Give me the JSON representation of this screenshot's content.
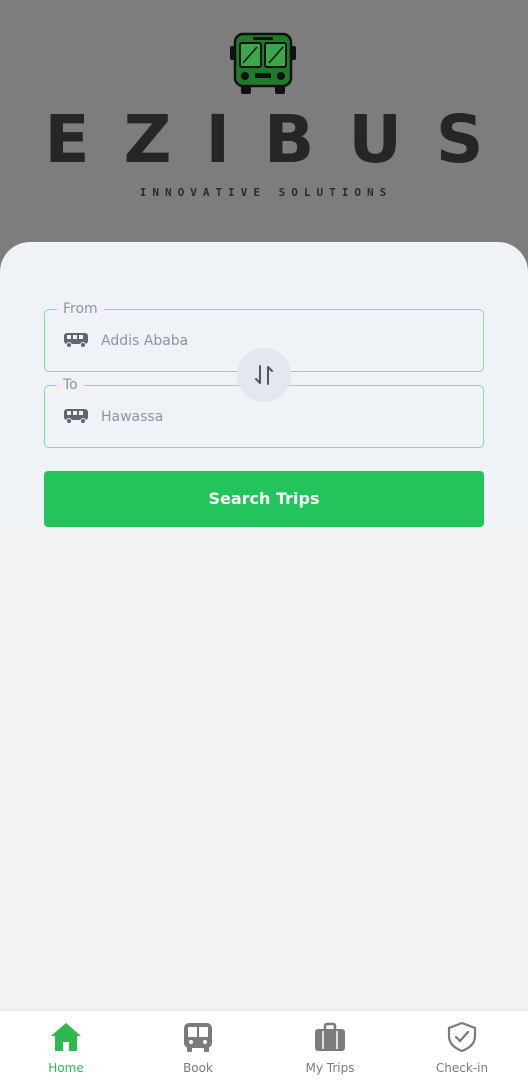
{
  "header": {
    "brand": "EZIBUS",
    "tagline": "INNOVATIVE SOLUTIONS",
    "logo_icon": "bus-logo-icon"
  },
  "search": {
    "from": {
      "label": "From",
      "value": "Addis Ababa",
      "icon": "bus-icon"
    },
    "to": {
      "label": "To",
      "value": "Hawassa",
      "icon": "bus-icon"
    },
    "swap_icon": "swap-vertical-icon",
    "button_label": "Search Trips"
  },
  "nav": {
    "items": [
      {
        "label": "Home",
        "icon": "home-icon",
        "active": true
      },
      {
        "label": "Book",
        "icon": "bus-icon",
        "active": false
      },
      {
        "label": "My Trips",
        "icon": "briefcase-icon",
        "active": false
      },
      {
        "label": "Check-in",
        "icon": "shield-check-icon",
        "active": false
      }
    ]
  },
  "colors": {
    "accent": "#24c45c",
    "field_border": "#7fe09a",
    "header_bg": "#7d7d7d",
    "card_bg": "#eff2f7"
  }
}
